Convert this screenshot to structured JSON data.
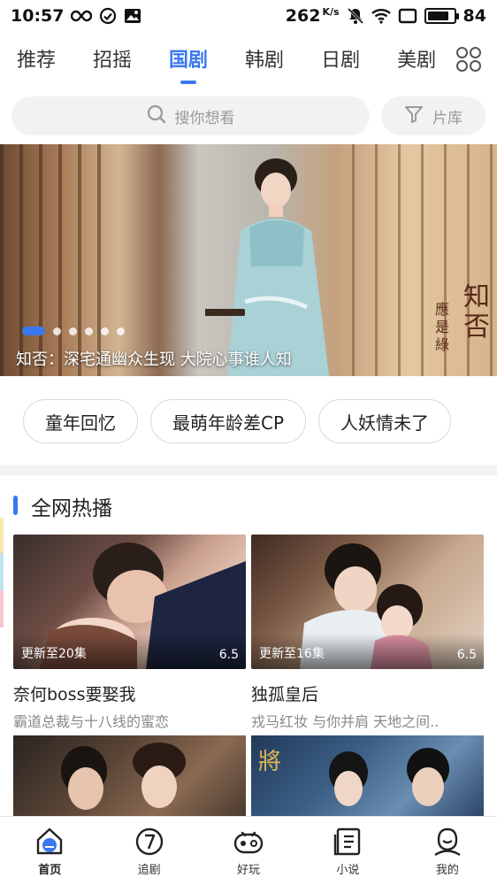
{
  "status_bar": {
    "time": "10:57",
    "speed": "262",
    "speed_unit": "K/s",
    "battery": "84",
    "battery_level": 0.84
  },
  "tabs": [
    {
      "label": "推荐",
      "active": false
    },
    {
      "label": "招摇",
      "active": false
    },
    {
      "label": "国剧",
      "active": true
    },
    {
      "label": "韩剧",
      "active": false
    },
    {
      "label": "日剧",
      "active": false
    },
    {
      "label": "美剧",
      "active": false
    }
  ],
  "search": {
    "placeholder": "搜你想看",
    "library_label": "片库"
  },
  "banner": {
    "caption": "知否：深宅通幽众生现 大院心事谁人知",
    "slide_count": 6,
    "active_slide": 0
  },
  "chips": [
    "童年回忆",
    "最萌年龄差CP",
    "人妖情未了"
  ],
  "section": {
    "title": "全网热播"
  },
  "cards": [
    {
      "episode": "更新至20集",
      "score": "6.5",
      "name": "奈何boss要娶我",
      "desc": "霸道总裁与十八线的蜜恋"
    },
    {
      "episode": "更新至16集",
      "score": "6.5",
      "name": "独孤皇后",
      "desc": "戎马红妆 与你并肩 天地之间.."
    }
  ],
  "bottom_nav": [
    {
      "label": "首页",
      "icon": "home-icon",
      "active": true
    },
    {
      "label": "追剧",
      "icon": "follow-icon",
      "active": false
    },
    {
      "label": "好玩",
      "icon": "gamepad-icon",
      "active": false
    },
    {
      "label": "小说",
      "icon": "book-icon",
      "active": false
    },
    {
      "label": "我的",
      "icon": "profile-icon",
      "active": false
    }
  ],
  "colors": {
    "accent": "#3a78f0",
    "text": "#222222",
    "muted": "#888888",
    "search_bg": "#f1f2f4"
  }
}
